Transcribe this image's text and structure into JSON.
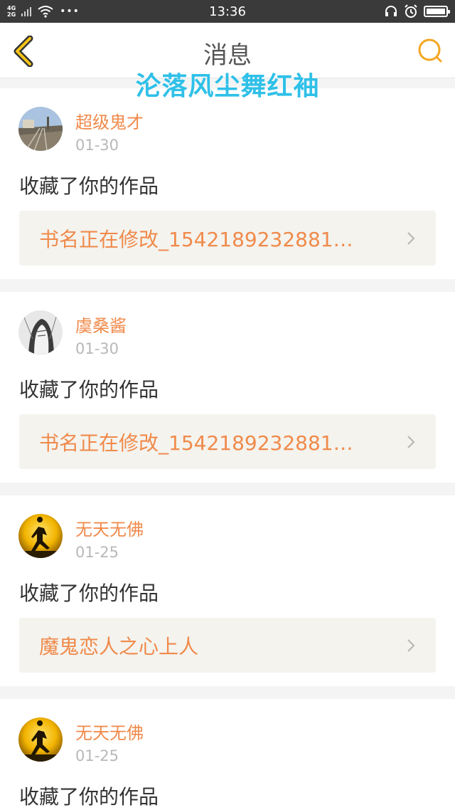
{
  "status_bar": {
    "network_top": "4G",
    "network_bottom": "2G",
    "dots": "•••",
    "time": "13:36",
    "icons": [
      "signal-icon",
      "wifi-icon",
      "headphone-icon",
      "alarm-icon",
      "battery-icon"
    ],
    "battery_level": 1.0
  },
  "nav": {
    "title": "消息",
    "back_icon": "chevron-left-icon",
    "search_icon": "search-icon",
    "accent_color": "#f5a623"
  },
  "watermark": "沦落风尘舞红袖",
  "messages": [
    {
      "user": "超级鬼才",
      "date": "01-30",
      "action": "收藏了你的作品",
      "work": "书名正在修改_1542189232881…",
      "avatar": "railway-photo-avatar"
    },
    {
      "user": "虞桑酱",
      "date": "01-30",
      "action": "收藏了你的作品",
      "work": "书名正在修改_1542189232881…",
      "avatar": "sketch-portrait-avatar"
    },
    {
      "user": "无天无佛",
      "date": "01-25",
      "action": "收藏了你的作品",
      "work": "魔鬼恋人之心上人",
      "avatar": "sunset-runner-avatar"
    },
    {
      "user": "无天无佛",
      "date": "01-25",
      "action": "收藏了你的作品",
      "work": "",
      "avatar": "sunset-runner-avatar"
    }
  ],
  "colors": {
    "username": "#f08a4b",
    "date": "#b8b8b8",
    "link_bg": "#f4f3ee",
    "watermark": "#2fc0e8"
  }
}
